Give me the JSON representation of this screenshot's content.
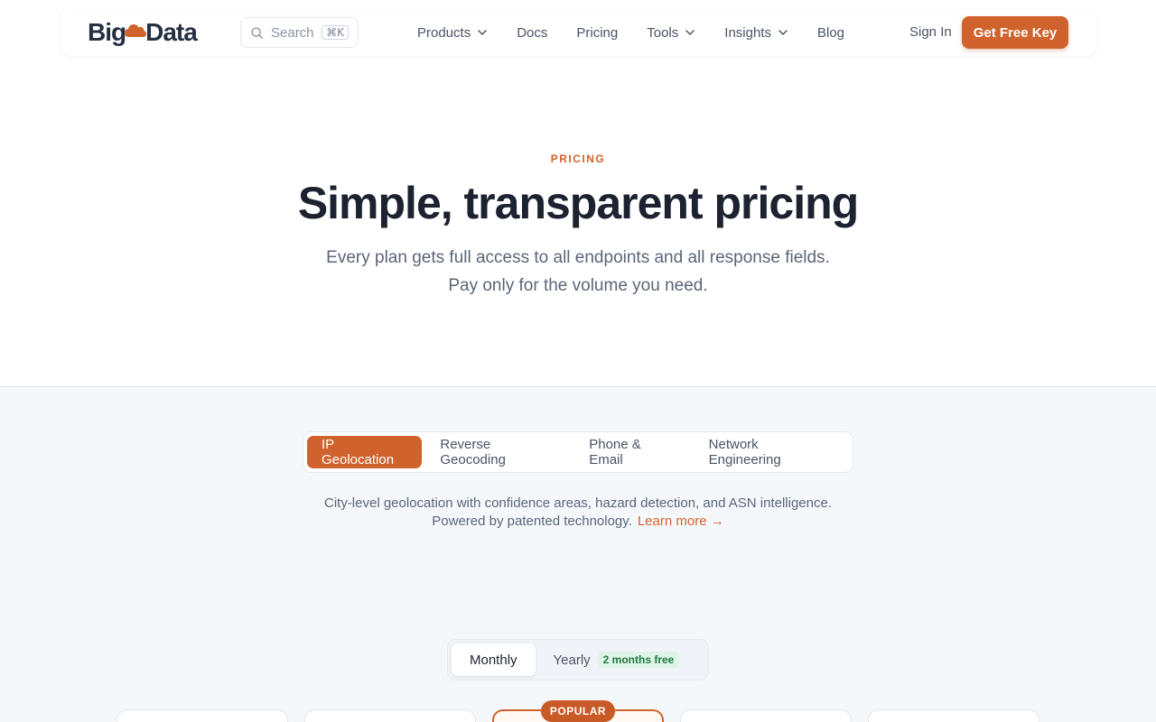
{
  "brand": {
    "logo_left": "Big",
    "logo_right": "Data",
    "accent": "#d0632d"
  },
  "header": {
    "search_placeholder": "Search",
    "search_shortcut": "⌘K",
    "menu": [
      {
        "label": "Products",
        "dropdown": true
      },
      {
        "label": "Docs",
        "dropdown": false
      },
      {
        "label": "Pricing",
        "dropdown": false
      },
      {
        "label": "Tools",
        "dropdown": true
      },
      {
        "label": "Insights",
        "dropdown": true
      },
      {
        "label": "Blog",
        "dropdown": false
      }
    ],
    "sign_in": "Sign In",
    "cta": "Get Free Key"
  },
  "hero": {
    "eyebrow": "PRICING",
    "title": "Simple, transparent pricing",
    "subtitle_line1": "Every plan gets full access to all endpoints and all response fields.",
    "subtitle_line2": "Pay only for the volume you need."
  },
  "products": {
    "tabs": [
      "IP Geolocation",
      "Reverse Geocoding",
      "Phone & Email",
      "Network Engineering"
    ],
    "active_tab": 0,
    "description_line1": "City-level geolocation with confidence areas, hazard detection, and ASN intelligence.",
    "description_line2": "Powered by patented technology.",
    "learn_more": "Learn more →"
  },
  "billing": {
    "monthly": "Monthly",
    "yearly": "Yearly",
    "yearly_badge": "2 months free",
    "selected": "Monthly"
  },
  "plans": {
    "popular_badge": "POPULAR"
  }
}
